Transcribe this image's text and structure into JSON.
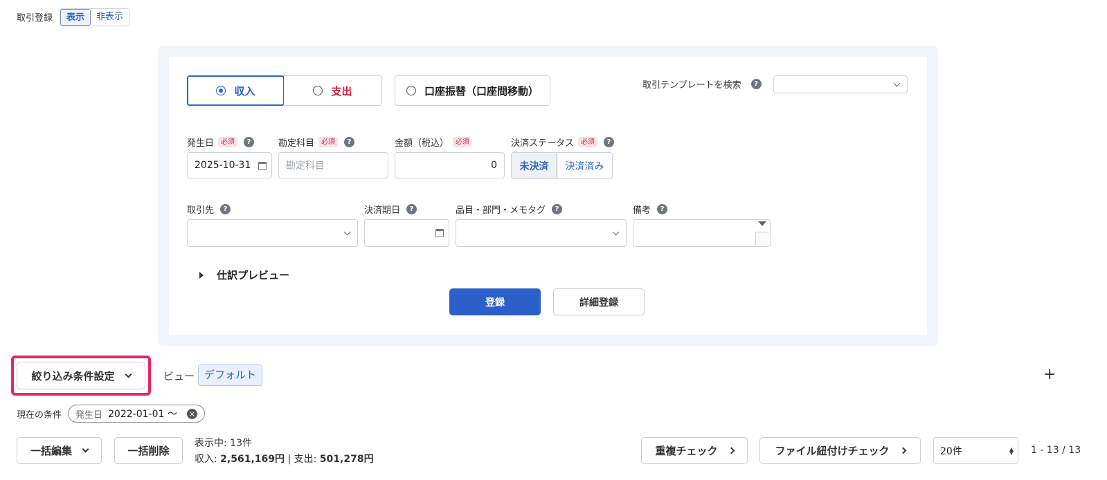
{
  "top": {
    "label": "取引登録",
    "show": "表示",
    "hide": "非表示"
  },
  "form": {
    "type_income": "収入",
    "type_expense": "支出",
    "type_transfer": "口座振替（口座間移動）",
    "template_label": "取引テンプレートを検索",
    "required": "必須",
    "date_label": "発生日",
    "date_value": "2025-10-31",
    "account_label": "勘定科目",
    "account_placeholder": "勘定科目",
    "amount_label": "金額（税込）",
    "amount_value": "0",
    "status_label": "決済ステータス",
    "status_unsettled": "未決済",
    "status_settled": "決済済み",
    "partner_label": "取引先",
    "due_label": "決済期日",
    "item_label": "品目・部門・メモタグ",
    "memo_label": "備考",
    "preview_label": "仕訳プレビュー",
    "submit": "登録",
    "detail_submit": "詳細登録"
  },
  "filter": {
    "button": "絞り込み条件設定",
    "view_label": "ビュー",
    "view_value": "デフォルト",
    "add": "+",
    "current_label": "現在の条件",
    "chip_key": "発生日",
    "chip_value": "2022-01-01 〜"
  },
  "toolbar": {
    "bulk_edit": "一括編集",
    "bulk_delete": "一括削除",
    "showing": "表示中: 13件",
    "income_label": "収入: ",
    "income_value": "2,561,169円",
    "separator": " | 支出: ",
    "expense_value": "501,278円",
    "dup_check": "重複チェック",
    "file_check": "ファイル紐付けチェック",
    "per_page": "20件",
    "range": "1 - 13 / 13"
  },
  "colors": {
    "accent": "#2b63c9",
    "expense_red": "#d0213c",
    "highlight": "#e8236b"
  }
}
